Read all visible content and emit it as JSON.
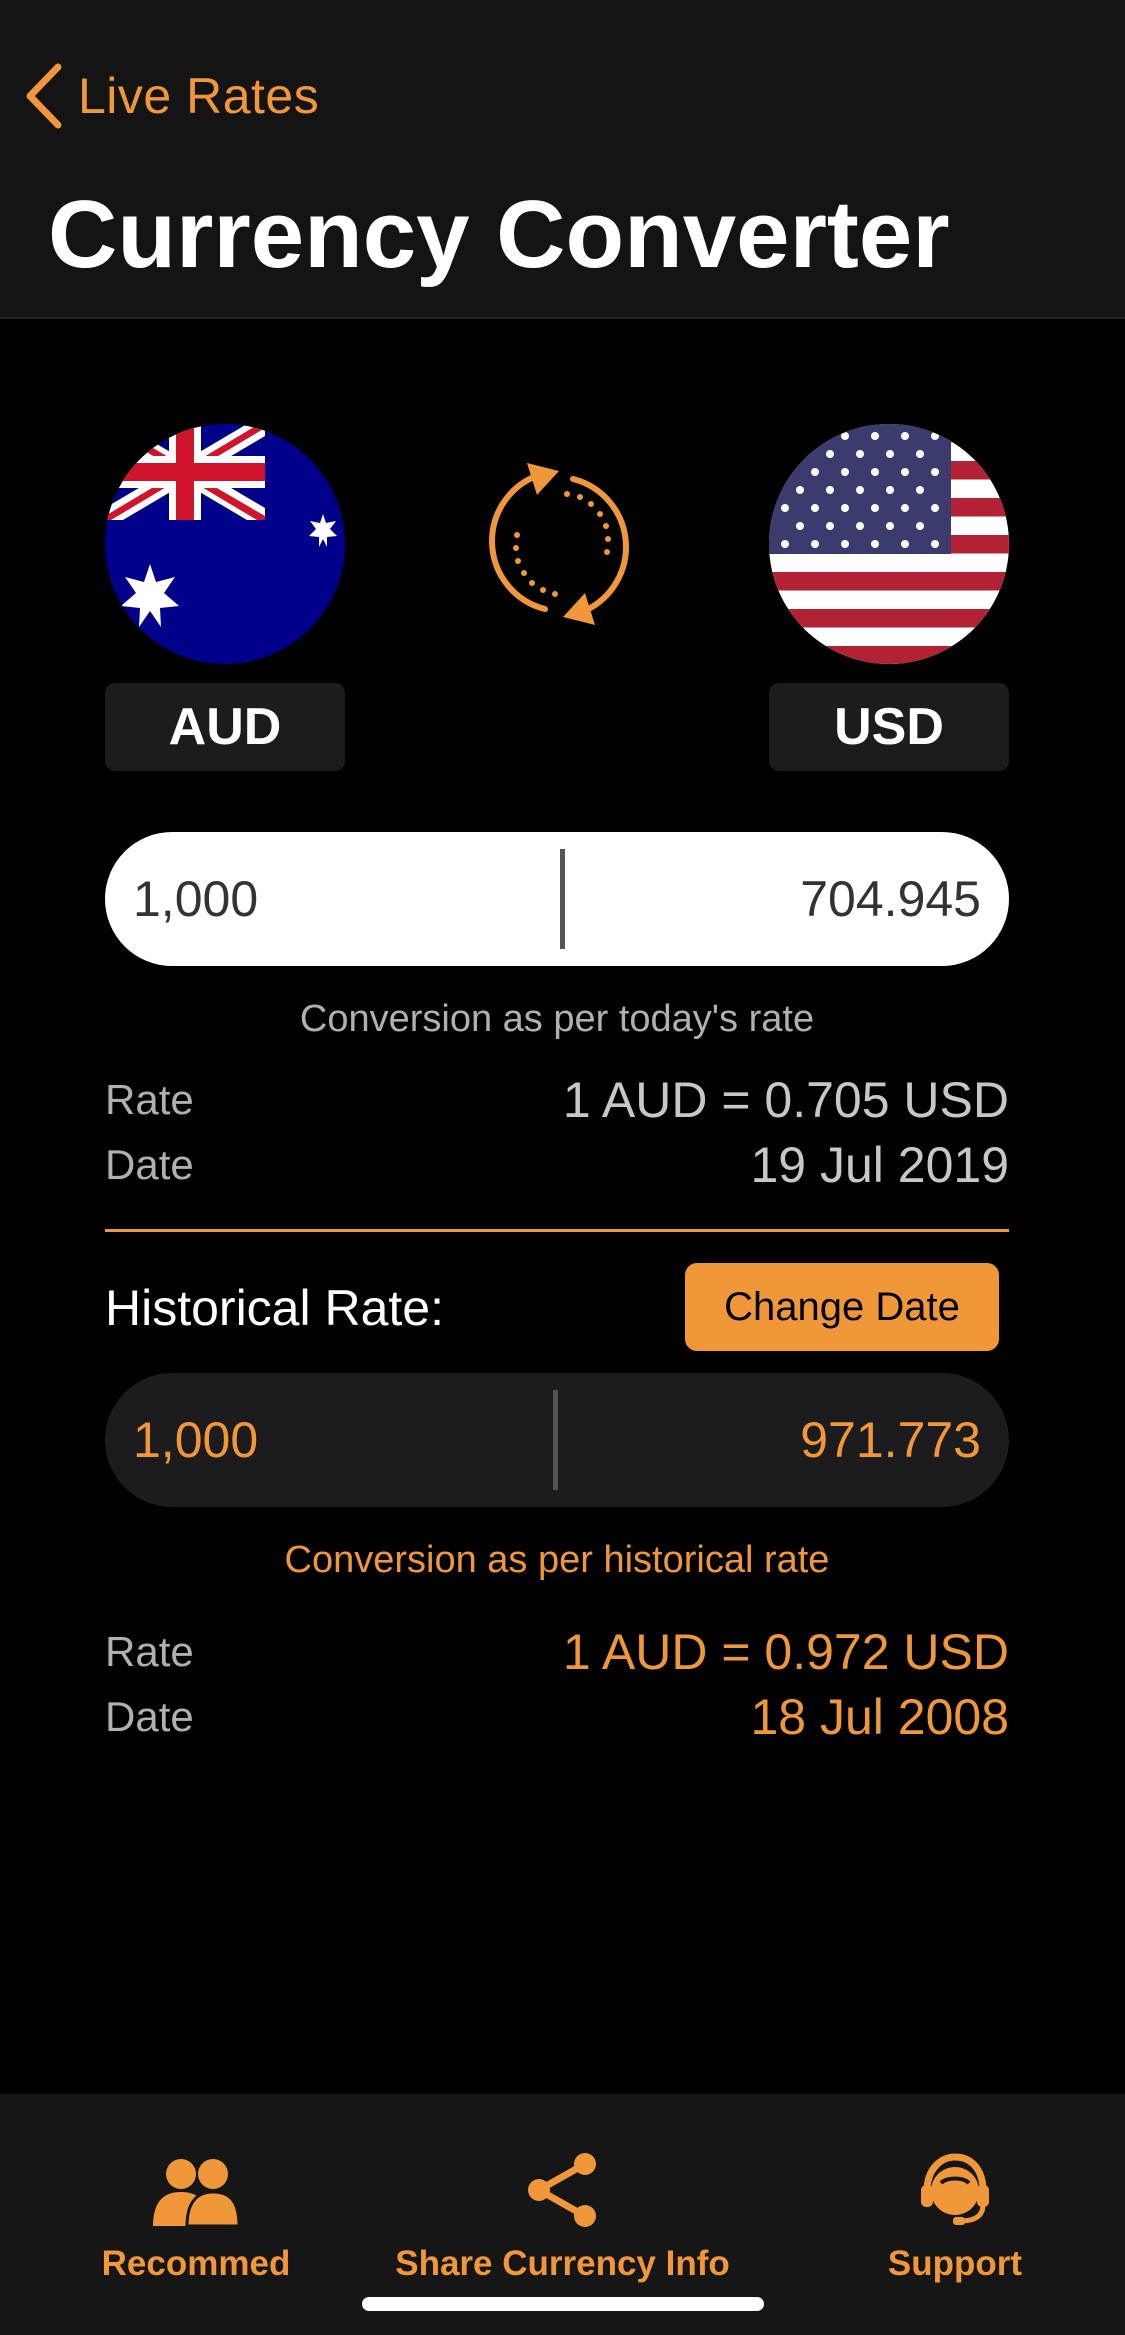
{
  "header": {
    "back_label": "Live Rates",
    "title": "Currency Converter"
  },
  "currencies": {
    "from": {
      "code": "AUD",
      "flag_icon": "australia-flag-icon"
    },
    "to": {
      "code": "USD",
      "flag_icon": "usa-flag-icon"
    },
    "swap_icon": "swap-arrows-icon"
  },
  "live": {
    "from_amount": "1,000",
    "to_amount": "704.945",
    "caption": "Conversion as per today's rate",
    "rate_label": "Rate",
    "rate_value": "1 AUD = 0.705 USD",
    "date_label": "Date",
    "date_value": "19 Jul 2019"
  },
  "historical": {
    "title": "Historical Rate:",
    "change_date_label": "Change Date",
    "from_amount": "1,000",
    "to_amount": "971.773",
    "caption": "Conversion as per historical rate",
    "rate_label": "Rate",
    "rate_value": "1 AUD = 0.972 USD",
    "date_label": "Date",
    "date_value": "18 Jul 2008"
  },
  "tabbar": {
    "recommend_label": "Recommed",
    "share_label": "Share Currency Info",
    "support_label": "Support"
  },
  "colors": {
    "accent": "#F0973A",
    "background": "#000000",
    "header_bg": "#141414",
    "chip_bg": "#1C1C1E"
  }
}
